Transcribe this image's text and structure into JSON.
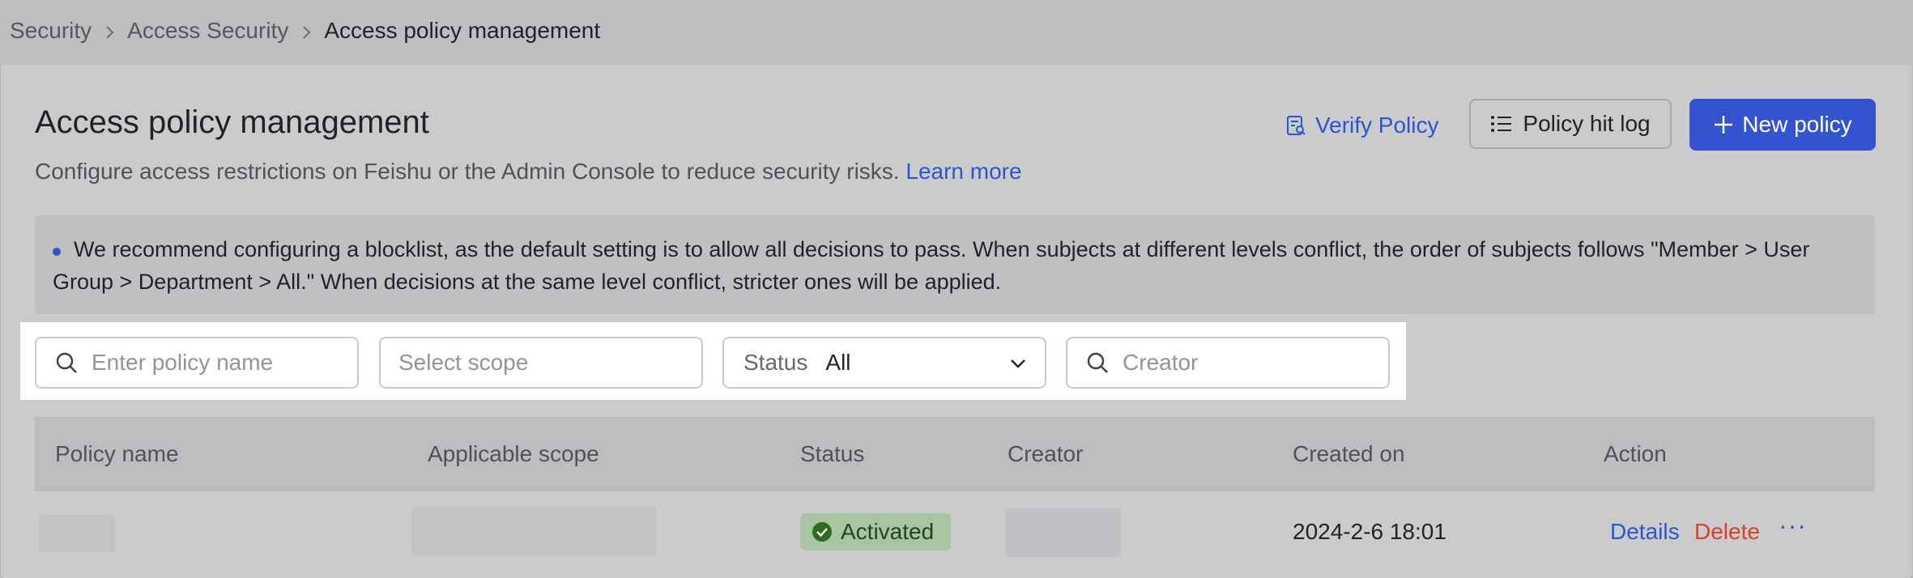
{
  "breadcrumb": {
    "items": [
      "Security",
      "Access Security",
      "Access policy management"
    ]
  },
  "header": {
    "title": "Access policy management",
    "subtitle": "Configure access restrictions on Feishu or the Admin Console to reduce security risks.",
    "learn_more": "Learn more",
    "verify_policy": "Verify Policy",
    "policy_hit_log": "Policy hit log",
    "new_policy": "New policy"
  },
  "notice": {
    "text": "We recommend configuring a blocklist, as the default setting is to allow all decisions to pass. When subjects at different levels conflict, the order of subjects follows \"Member > User Group > Department > All.\" When decisions at the same level conflict, stricter ones will be applied."
  },
  "filters": {
    "policy_name_placeholder": "Enter policy name",
    "scope_placeholder": "Select scope",
    "status_label": "Status",
    "status_value": "All",
    "creator_placeholder": "Creator"
  },
  "table": {
    "columns": [
      "Policy name",
      "Applicable scope",
      "Status",
      "Creator",
      "Created on",
      "Action"
    ],
    "rows": [
      {
        "status": "Activated",
        "created_on": "2024-2-6 18:01",
        "actions": {
          "details": "Details",
          "delete": "Delete",
          "more": "···"
        }
      }
    ]
  },
  "colors": {
    "accent": "#3353cf",
    "link": "#2d55d0",
    "danger": "#d6402f",
    "success_badge": "#a9c4a2"
  },
  "icons": {
    "verify": "document-search-icon",
    "hit_log": "list-icon",
    "new": "plus-icon",
    "search": "search-icon",
    "dropdown": "chevron-down-icon",
    "status": "check-circle-icon",
    "breadcrumb_sep": "chevron-right-icon"
  }
}
